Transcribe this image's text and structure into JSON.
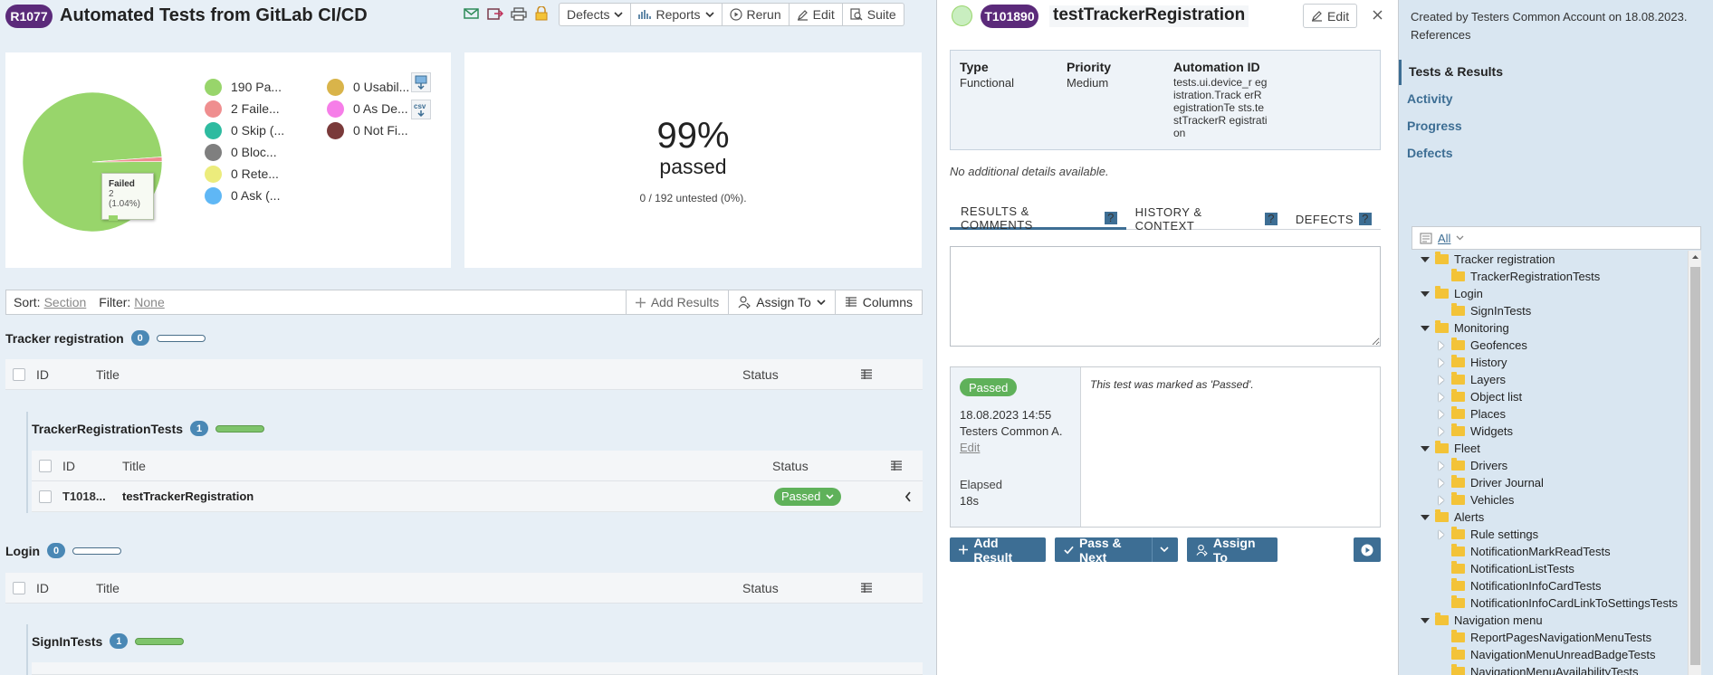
{
  "run": {
    "id": "R1077",
    "title": "Automated Tests from GitLab CI/CD"
  },
  "toolbar": {
    "defects": "Defects",
    "reports": "Reports",
    "rerun": "Rerun",
    "edit": "Edit",
    "suite": "Suite"
  },
  "chart_data": {
    "type": "pie",
    "slices": [
      {
        "label": "Passed",
        "value": 190,
        "color": "#98d56b"
      },
      {
        "label": "Failed",
        "value": 2,
        "color": "#ef8e8f"
      }
    ],
    "tooltip": {
      "label": "Failed",
      "value": "2 (1.04%)"
    }
  },
  "legend": [
    {
      "label": "190 Pa...",
      "color": "#98d56b"
    },
    {
      "label": "2 Faile...",
      "color": "#ef8e8f"
    },
    {
      "label": "0 Skip (...",
      "color": "#2ebba0"
    },
    {
      "label": "0 Bloc...",
      "color": "#7f7f7f"
    },
    {
      "label": "0 Rete...",
      "color": "#ecec7c"
    },
    {
      "label": "0 Ask (...",
      "color": "#5fb7f5"
    },
    {
      "label": "0 Usabil...",
      "color": "#d9b44a"
    },
    {
      "label": "0 As De...",
      "color": "#f67ee8"
    },
    {
      "label": "0 Not Fi...",
      "color": "#7a3a3a"
    }
  ],
  "summary": {
    "percent": "99%",
    "passed_label": "passed",
    "untested": "0 / 192 untested (0%)."
  },
  "filterbar": {
    "sort_label": "Sort:",
    "sort_value": "Section",
    "filter_label": "Filter:",
    "filter_value": "None",
    "add_results": "Add Results",
    "assign_to": "Assign To",
    "columns": "Columns"
  },
  "columns": {
    "id": "ID",
    "title": "Title",
    "status": "Status"
  },
  "sections": [
    {
      "name": "Tracker registration",
      "count": "0"
    },
    {
      "name": "TrackerRegistrationTests",
      "count": "1"
    },
    {
      "name": "Login",
      "count": "0"
    },
    {
      "name": "SignInTests",
      "count": "1"
    }
  ],
  "test_row": {
    "id": "T1018...",
    "title": "testTrackerRegistration",
    "status": "Passed"
  },
  "detail": {
    "id": "T101890",
    "title": "testTrackerRegistration",
    "edit": "Edit",
    "fields": [
      {
        "label": "Type",
        "value": "Functional"
      },
      {
        "label": "Priority",
        "value": "Medium"
      },
      {
        "label": "Automation ID",
        "value": "tests.ui.device_r egistration.Track erRegistrationTe sts.testTrackerR egistration"
      }
    ],
    "no_details": "No additional details available.",
    "tabs": [
      "RESULTS & COMMENTS",
      "HISTORY & CONTEXT",
      "DEFECTS"
    ],
    "result": {
      "status": "Passed",
      "date": "18.08.2023 14:55",
      "user": "Testers Common A.",
      "edit": "Edit",
      "elapsed_label": "Elapsed",
      "elapsed_value": "18s",
      "comment": "This test was marked as 'Passed'."
    },
    "actions": {
      "add_result": "Add Result",
      "pass_next": "Pass & Next",
      "assign_to": "Assign To"
    }
  },
  "sidebar": {
    "created": "Created by Testers Common Account on 18.08.2023.",
    "references": "References",
    "nav": [
      "Tests & Results",
      "Activity",
      "Progress",
      "Defects"
    ],
    "filter": "All",
    "tree": [
      {
        "label": "Tracker registration",
        "level": 0,
        "exp": "open"
      },
      {
        "label": "TrackerRegistrationTests",
        "level": 1,
        "exp": "none"
      },
      {
        "label": "Login",
        "level": 0,
        "exp": "open"
      },
      {
        "label": "SignInTests",
        "level": 1,
        "exp": "none"
      },
      {
        "label": "Monitoring",
        "level": 0,
        "exp": "open"
      },
      {
        "label": "Geofences",
        "level": 1,
        "exp": "closed"
      },
      {
        "label": "History",
        "level": 1,
        "exp": "closed"
      },
      {
        "label": "Layers",
        "level": 1,
        "exp": "closed"
      },
      {
        "label": "Object list",
        "level": 1,
        "exp": "closed"
      },
      {
        "label": "Places",
        "level": 1,
        "exp": "closed"
      },
      {
        "label": "Widgets",
        "level": 1,
        "exp": "closed"
      },
      {
        "label": "Fleet",
        "level": 0,
        "exp": "open"
      },
      {
        "label": "Drivers",
        "level": 1,
        "exp": "closed"
      },
      {
        "label": "Driver Journal",
        "level": 1,
        "exp": "closed"
      },
      {
        "label": "Vehicles",
        "level": 1,
        "exp": "closed"
      },
      {
        "label": "Alerts",
        "level": 0,
        "exp": "open"
      },
      {
        "label": "Rule settings",
        "level": 1,
        "exp": "closed"
      },
      {
        "label": "NotificationMarkReadTests",
        "level": 1,
        "exp": "none"
      },
      {
        "label": "NotificationListTests",
        "level": 1,
        "exp": "none"
      },
      {
        "label": "NotificationInfoCardTests",
        "level": 1,
        "exp": "none"
      },
      {
        "label": "NotificationInfoCardLinkToSettingsTests",
        "level": 1,
        "exp": "none"
      },
      {
        "label": "Navigation menu",
        "level": 0,
        "exp": "open"
      },
      {
        "label": "ReportPagesNavigationMenuTests",
        "level": 1,
        "exp": "none"
      },
      {
        "label": "NavigationMenuUnreadBadgeTests",
        "level": 1,
        "exp": "none"
      },
      {
        "label": "NavigationMenuAvailabilityTests",
        "level": 1,
        "exp": "none"
      }
    ]
  }
}
